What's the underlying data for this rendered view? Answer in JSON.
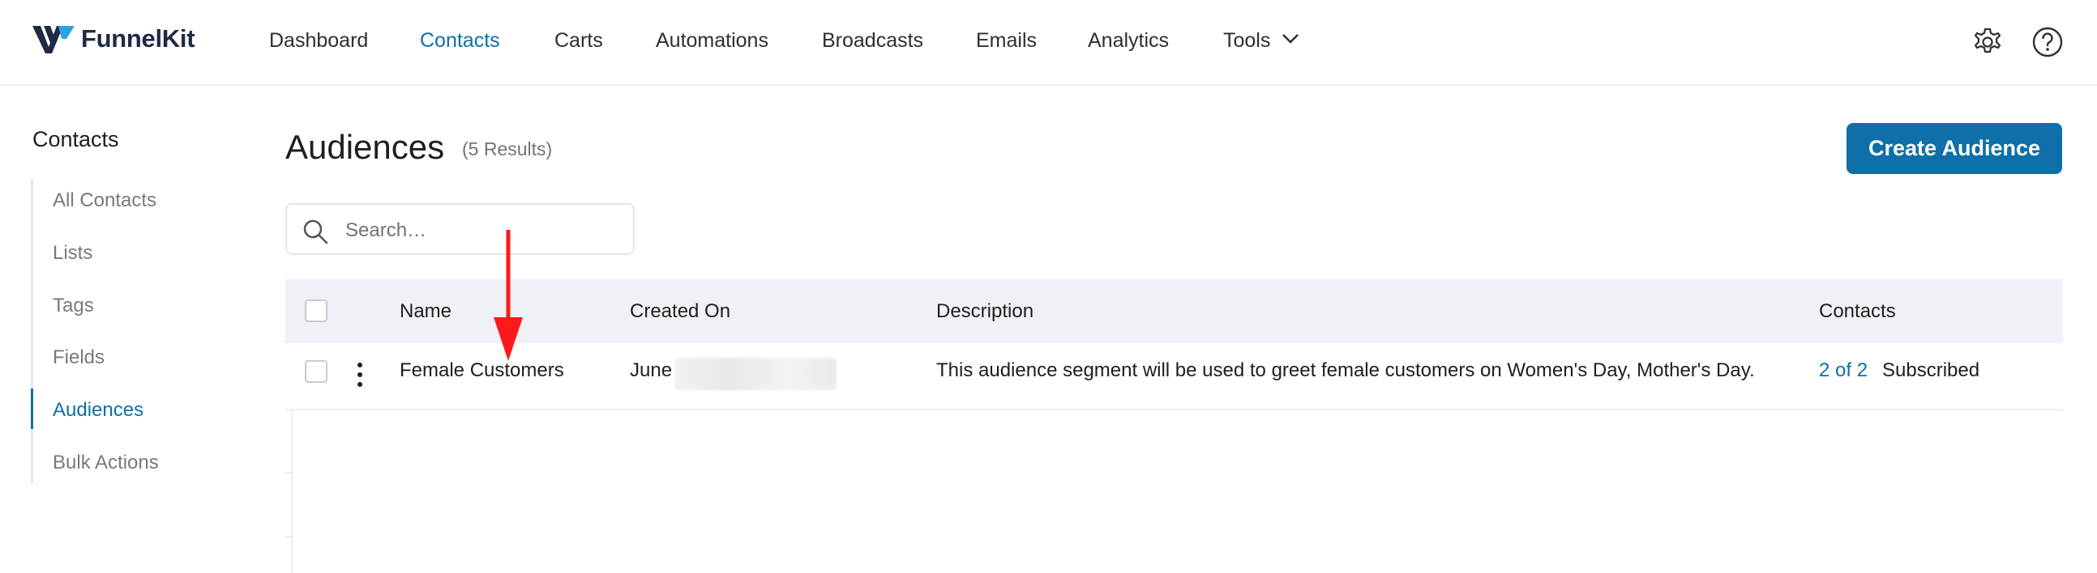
{
  "brand": {
    "name": "FunnelKit"
  },
  "nav": {
    "items": [
      "Dashboard",
      "Contacts",
      "Carts",
      "Automations",
      "Broadcasts",
      "Emails",
      "Analytics",
      "Tools"
    ],
    "active": "Contacts",
    "settings_icon": "gear-icon",
    "help_icon": "question-circle-icon"
  },
  "sidebar": {
    "title": "Contacts",
    "items": [
      "All Contacts",
      "Lists",
      "Tags",
      "Fields",
      "Audiences",
      "Bulk Actions"
    ],
    "active": "Audiences"
  },
  "page": {
    "title": "Audiences",
    "results": "(5 Results)",
    "create_button": "Create Audience"
  },
  "search": {
    "placeholder": "Search…",
    "value": ""
  },
  "table": {
    "columns": [
      "Name",
      "Created On",
      "Description",
      "Contacts"
    ],
    "rows": [
      {
        "name": "Female Customers",
        "created_on": "June",
        "description": "This audience segment will be used to greet female customers on Women's Day, Mother's Day.",
        "contacts_count": "2 of 2",
        "contacts_status": "Subscribed"
      }
    ]
  },
  "colors": {
    "accent": "#0f6fa8",
    "header_bg": "#f0f1f6",
    "annotation_arrow": "#ff1a1a"
  }
}
